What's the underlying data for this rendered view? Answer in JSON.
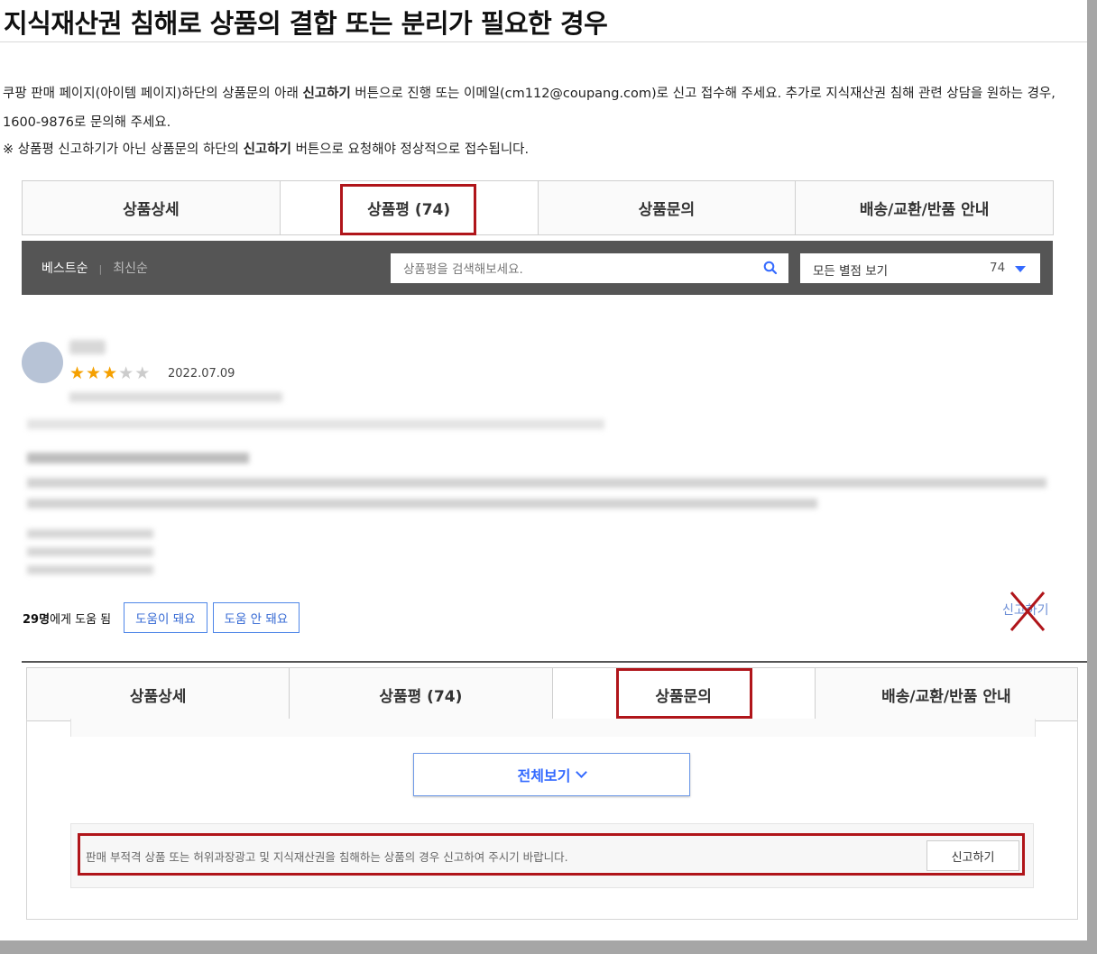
{
  "heading": "지식재산권 침해로 상품의 결합 또는 분리가 필요한 경우",
  "instructions": {
    "line1_pre": "쿠팡 판매 페이지(아이템 페이지)하단의 상품문의 아래 ",
    "line1_bold": "신고하기",
    "line1_post": " 버튼으로 진행 또는 이메일(cm112@coupang.com)로 신고 접수해 주세요. 추가로 지식재산권 침해 관련 상담을 원하는 경우, 1600-9876로 문의해 주세요.",
    "note_pre": "※ 상품평 신고하기가 아닌 상품문의 하단의 ",
    "note_bold": "신고하기",
    "note_post": " 버튼으로 요청해야 정상적으로 접수됩니다."
  },
  "tabs_top": [
    "상품상세",
    "상품평 (74)",
    "상품문의",
    "배송/교환/반품 안내"
  ],
  "review_toolbar": {
    "sort_best": "베스트순",
    "sort_sep": "|",
    "sort_new": "최신순",
    "search_placeholder": "상품평을 검색해보세요.",
    "filter_label": "모든 별점 보기",
    "filter_count": "74"
  },
  "review": {
    "rating": 3,
    "max_rating": 5,
    "date": "2022.07.09"
  },
  "helpful": {
    "count": "29명",
    "suffix": "에게 도움 됨",
    "yes_label": "도움이 돼요",
    "no_label": "도움 안 돼요",
    "report_label": "신고하기"
  },
  "tabs_bottom": [
    "상품상세",
    "상품평 (74)",
    "상품문의",
    "배송/교환/반품 안내"
  ],
  "inquiry": {
    "view_all_label": "전체보기",
    "notice_text": "판매 부적격 상품 또는 허위과장광고 및 지식재산권을 침해하는 상품의 경우 신고하여 주시기 바랍니다.",
    "report_label": "신고하기"
  },
  "colors": {
    "highlight": "#b0151a",
    "accent_blue": "#346aff",
    "star": "#f5a000",
    "toolbar_bg": "#555555"
  }
}
